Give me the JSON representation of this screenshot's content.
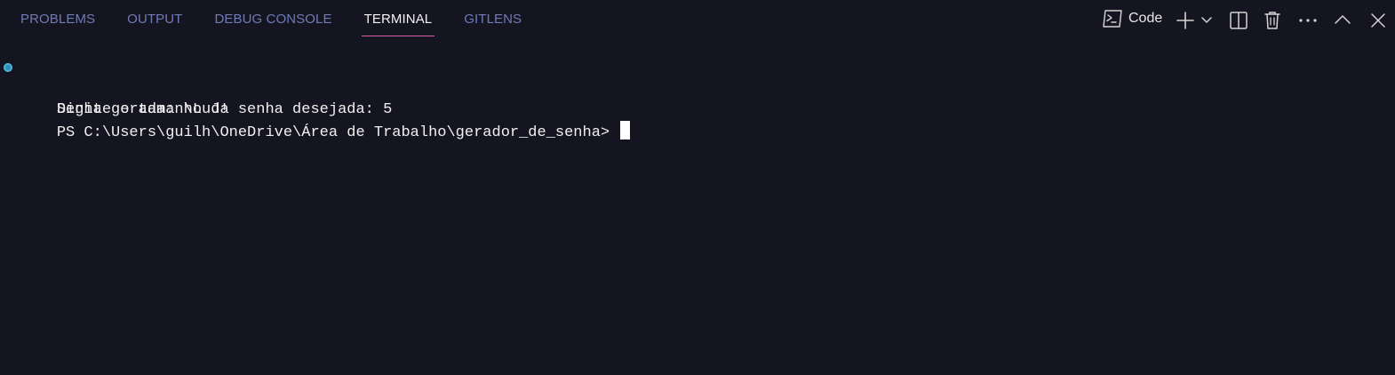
{
  "panel": {
    "tabs": [
      {
        "label": "PROBLEMS",
        "active": false
      },
      {
        "label": "OUTPUT",
        "active": false
      },
      {
        "label": "DEBUG CONSOLE",
        "active": false
      },
      {
        "label": "TERMINAL",
        "active": true
      },
      {
        "label": "GITLENS",
        "active": false
      }
    ],
    "terminal_profile": "Code",
    "accent_color": "#d95fa6"
  },
  "terminal": {
    "lines": [
      "Digite o tamanho da senha desejada: 5",
      "Senha gerada: \\LuJ!",
      "PS C:\\Users\\guilh\\OneDrive\\Área de Trabalho\\gerador_de_senha>"
    ]
  },
  "icons": {
    "profile": "terminal-powershell-icon",
    "new": "plus-icon",
    "dropdown": "chevron-down-icon",
    "split": "split-terminal-icon",
    "kill": "trash-icon",
    "more": "ellipsis-icon",
    "maximize": "chevron-up-icon",
    "close": "close-icon"
  }
}
